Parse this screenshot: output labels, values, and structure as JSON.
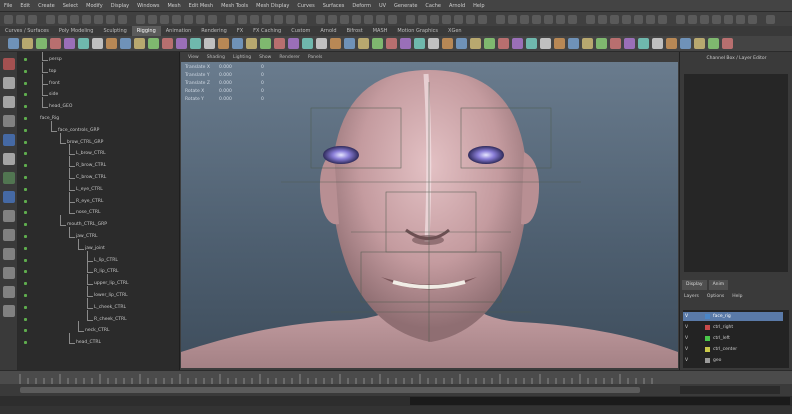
{
  "menubar": {
    "items": [
      "File",
      "Edit",
      "Create",
      "Select",
      "Modify",
      "Display",
      "Windows",
      "Mesh",
      "Edit Mesh",
      "Mesh Tools",
      "Mesh Display",
      "Curves",
      "Surfaces",
      "Deform",
      "UV",
      "Generate",
      "Cache",
      "Arnold",
      "Help"
    ]
  },
  "shelf_tabs": [
    "Curves / Surfaces",
    "Poly Modeling",
    "Sculpting",
    "Rigging",
    "Animation",
    "Rendering",
    "FX",
    "FX Caching",
    "Custom",
    "Arnold",
    "Bifrost",
    "MASH",
    "Motion Graphics",
    "XGen"
  ],
  "shelf_active_index": 3,
  "outliner": {
    "rows": [
      {
        "label": "persp",
        "depth": 1
      },
      {
        "label": "top",
        "depth": 1
      },
      {
        "label": "front",
        "depth": 1
      },
      {
        "label": "side",
        "depth": 1
      },
      {
        "label": "head_GEO",
        "depth": 1
      },
      {
        "label": "face_Rig",
        "depth": 0
      },
      {
        "label": "face_controls_GRP",
        "depth": 2
      },
      {
        "label": "brow_CTRL_GRP",
        "depth": 3
      },
      {
        "label": "L_brow_CTRL",
        "depth": 4
      },
      {
        "label": "R_brow_CTRL",
        "depth": 4
      },
      {
        "label": "C_brow_CTRL",
        "depth": 4
      },
      {
        "label": "L_eye_CTRL",
        "depth": 4
      },
      {
        "label": "R_eye_CTRL",
        "depth": 4
      },
      {
        "label": "nose_CTRL",
        "depth": 4
      },
      {
        "label": "mouth_CTRL_GRP",
        "depth": 3
      },
      {
        "label": "jaw_CTRL",
        "depth": 4
      },
      {
        "label": "jaw_joint",
        "depth": 5
      },
      {
        "label": "L_lip_CTRL",
        "depth": 6
      },
      {
        "label": "R_lip_CTRL",
        "depth": 6
      },
      {
        "label": "upper_lip_CTRL",
        "depth": 6
      },
      {
        "label": "lower_lip_CTRL",
        "depth": 6
      },
      {
        "label": "L_cheek_CTRL",
        "depth": 6
      },
      {
        "label": "R_cheek_CTRL",
        "depth": 6
      },
      {
        "label": "neck_CTRL",
        "depth": 5
      },
      {
        "label": "head_CTRL",
        "depth": 4
      }
    ]
  },
  "viewport": {
    "menu": [
      "View",
      "Shading",
      "Lighting",
      "Show",
      "Renderer",
      "Panels"
    ],
    "channels": [
      {
        "name": "Translate X",
        "value": "0.000",
        "zero": "0"
      },
      {
        "name": "Translate Y",
        "value": "0.000",
        "zero": "0"
      },
      {
        "name": "Translate Z",
        "value": "0.000",
        "zero": "0"
      },
      {
        "name": "Rotate X",
        "value": "0.000",
        "zero": "0"
      },
      {
        "name": "Rotate Y",
        "value": "0.000",
        "zero": "0"
      }
    ]
  },
  "right_panel": {
    "title": "Channel Box / Layer Editor",
    "layer_tabs": [
      "Display",
      "Anim"
    ],
    "layer_menu": [
      "Layers",
      "Options",
      "Help"
    ],
    "layers": [
      {
        "v": "V",
        "label": "face_rig",
        "color": "#4a86c8",
        "selected": true
      },
      {
        "v": "V",
        "label": "ctrl_right",
        "color": "#c84a4a",
        "selected": false
      },
      {
        "v": "V",
        "label": "ctrl_left",
        "color": "#4ac84a",
        "selected": false
      },
      {
        "v": "V",
        "label": "ctrl_center",
        "color": "#c8c84a",
        "selected": false
      },
      {
        "v": "V",
        "label": "geo",
        "color": "#9a9a9a",
        "selected": false
      }
    ]
  },
  "help_line": "",
  "colors": {
    "accent": "#5a7aa8",
    "outliner_dot": "#5fae4e",
    "skin": "#c9a3a6"
  }
}
